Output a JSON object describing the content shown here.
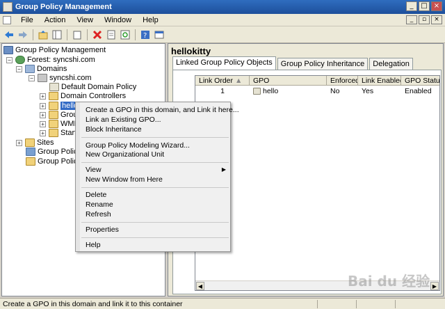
{
  "window": {
    "title": "Group Policy Management",
    "min": "_",
    "max": "□",
    "close": "×"
  },
  "menubar": {
    "items": [
      "File",
      "Action",
      "View",
      "Window",
      "Help"
    ],
    "mdi_min": "_",
    "mdi_restore": "▫",
    "mdi_close": "×"
  },
  "toolbar": {
    "icons": [
      "back-icon",
      "forward-icon",
      "up-icon",
      "tree-icon",
      "copy-icon",
      "delete-icon",
      "properties-icon",
      "refresh-icon",
      "help-icon",
      "console-icon"
    ]
  },
  "tree": {
    "root": "Group Policy Management",
    "forest": "Forest: syncshi.com",
    "domains": "Domains",
    "domain": "syncshi.com",
    "default_policy": "Default Domain Policy",
    "domain_controllers": "Domain Controllers",
    "hellokitty": "hellokitty",
    "group_policy_objects_partial": "Grou",
    "wmi_partial": "WMI",
    "starter_partial": "Start",
    "sites": "Sites",
    "modeling_partial": "Group Policy",
    "results_partial": "Group Policy"
  },
  "right": {
    "title": "hellokitty",
    "tabs": [
      "Linked Group Policy Objects",
      "Group Policy Inheritance",
      "Delegation"
    ],
    "columns": [
      "Link Order",
      "GPO",
      "Enforced",
      "Link Enabled",
      "GPO Status"
    ],
    "rows": [
      {
        "order": "1",
        "gpo": "hello",
        "enforced": "No",
        "link_enabled": "Yes",
        "status": "Enabled"
      }
    ]
  },
  "context_menu": {
    "items": [
      "Create a GPO in this domain, and Link it here...",
      "Link an Existing GPO...",
      "Block Inheritance",
      "Group Policy Modeling Wizard...",
      "New Organizational Unit",
      "View",
      "New Window from Here",
      "Delete",
      "Rename",
      "Refresh",
      "Properties",
      "Help"
    ]
  },
  "status": {
    "text": "Create a GPO in this domain and link it to this container"
  },
  "watermark": "Bai du 经验"
}
